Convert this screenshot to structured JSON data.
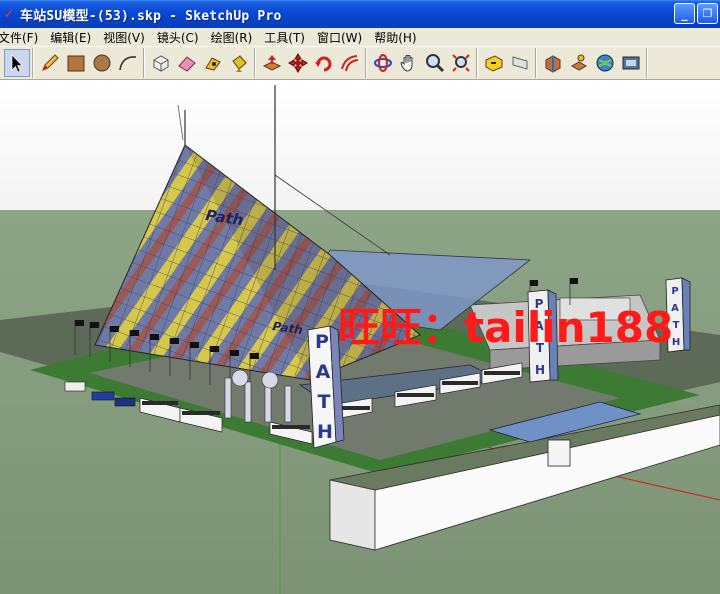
{
  "window": {
    "app_icon": "sketchup-icon",
    "title": "车站SU模型-(53).skp - SketchUp Pro",
    "buttons": {
      "minimize": "_",
      "restore": "❐"
    }
  },
  "menu": {
    "items": [
      {
        "label": "文件(F)"
      },
      {
        "label": "编辑(E)"
      },
      {
        "label": "视图(V)"
      },
      {
        "label": "镜头(C)"
      },
      {
        "label": "绘图(R)"
      },
      {
        "label": "工具(T)"
      },
      {
        "label": "窗口(W)"
      },
      {
        "label": "帮助(H)"
      }
    ]
  },
  "toolbar": {
    "tools": [
      {
        "name": "select-tool",
        "icon": "arrow-icon"
      },
      {
        "name": "pencil-tool",
        "icon": "pencil-icon"
      },
      {
        "name": "rectangle-tool",
        "icon": "rectangle-icon"
      },
      {
        "name": "circle-tool",
        "icon": "circle-icon"
      },
      {
        "name": "arc-tool",
        "icon": "arc-icon"
      },
      {
        "name": "make-component-tool",
        "icon": "component-icon"
      },
      {
        "name": "eraser-tool",
        "icon": "eraser-icon"
      },
      {
        "name": "tape-measure-tool",
        "icon": "tape-icon"
      },
      {
        "name": "paint-bucket-tool",
        "icon": "paint-bucket-icon"
      },
      {
        "name": "push-pull-tool",
        "icon": "push-pull-icon"
      },
      {
        "name": "move-tool",
        "icon": "move-icon"
      },
      {
        "name": "rotate-tool",
        "icon": "rotate-icon"
      },
      {
        "name": "offset-tool",
        "icon": "offset-icon"
      },
      {
        "name": "orbit-tool",
        "icon": "orbit-icon"
      },
      {
        "name": "pan-tool",
        "icon": "hand-icon"
      },
      {
        "name": "zoom-tool",
        "icon": "zoom-icon"
      },
      {
        "name": "zoom-extents-tool",
        "icon": "zoom-extents-icon"
      },
      {
        "name": "previous-view-tool",
        "icon": "previous-view-icon"
      },
      {
        "name": "next-view-tool",
        "icon": "next-view-icon"
      },
      {
        "name": "warehouse-tool",
        "icon": "warehouse-icon"
      },
      {
        "name": "place-model-tool",
        "icon": "place-model-icon"
      },
      {
        "name": "geolocation-tool",
        "icon": "globe-icon"
      },
      {
        "name": "extension-tool",
        "icon": "extension-icon"
      }
    ]
  },
  "scene": {
    "sign_text_big": "PATH",
    "roof_logo": "Path",
    "roof_logo_lower": "Path",
    "watermark": "旺旺：tailin188",
    "colors": {
      "sky": "#ffffff",
      "ground": "#8aa080",
      "watermark": "#ff1a1a"
    }
  }
}
